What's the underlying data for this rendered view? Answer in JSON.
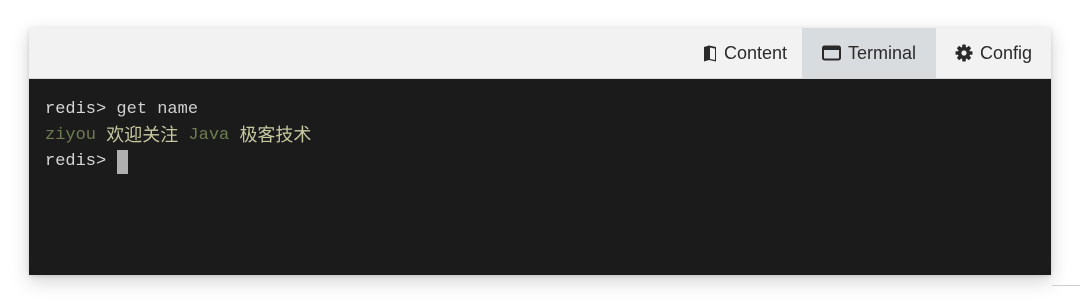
{
  "tabs": {
    "content": {
      "label": "Content",
      "icon": "book-icon"
    },
    "terminal": {
      "label": "Terminal",
      "icon": "window-icon",
      "active": true
    },
    "config": {
      "label": "Config",
      "icon": "gear-icon"
    }
  },
  "terminal": {
    "line1": {
      "prompt": "redis>",
      "command": "get name"
    },
    "line2": {
      "part1": "ziyou",
      "part2": "欢迎关注",
      "part3": "Java",
      "part4": "极客技术"
    },
    "line3": {
      "prompt": "redis>"
    }
  },
  "colors": {
    "terminal_bg": "#1b1b1b",
    "active_tab_bg": "#d9dcdf",
    "output_text": "#6e7d52"
  }
}
